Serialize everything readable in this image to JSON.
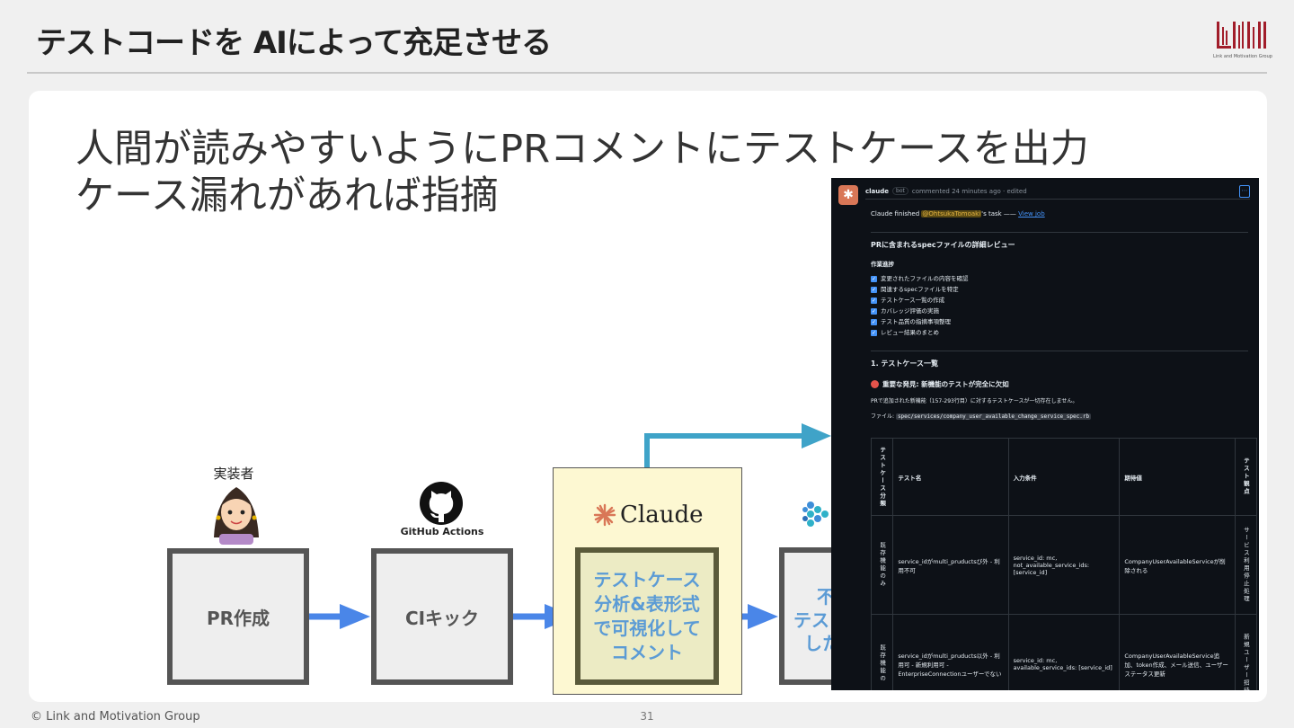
{
  "slide": {
    "title": "テストコードを AIによって充足させる",
    "headline_line1": "人間が読みやすいようにPRコメントにテストケースを出力",
    "headline_line2": "ケース漏れがあれば指摘",
    "logo_caption": "Link and Motivation Group",
    "footer_copyright": "© Link and Motivation Group",
    "page_number": "31"
  },
  "flow": {
    "actor_label": "実装者",
    "github_actions_label": "GitHub Actions",
    "claude_wordmark": "Claude",
    "steps": [
      {
        "label": "PR作成"
      },
      {
        "label": "CIキック"
      },
      {
        "lines": [
          "テストケース",
          "分析&表形式",
          "で可視化して",
          "コメント"
        ]
      },
      {
        "lines": [
          "不",
          "テス",
          "した"
        ]
      }
    ]
  },
  "comment": {
    "author": "claude",
    "bot_badge": "bot",
    "meta": "commented 24 minutes ago · edited",
    "finished_prefix": "Claude finished ",
    "mention": "@OhtsukaTomoaki",
    "finished_suffix": "'s task —— ",
    "view_job": "View job",
    "review_title": "PRに含まれるspecファイルの詳細レビュー",
    "progress_heading": "作業進捗",
    "tasks": [
      "変更されたファイルの内容を確認",
      "関連するspecファイルを特定",
      "テストケース一覧の作成",
      "カバレッジ評価の実施",
      "テスト品質の指摘事項整理",
      "レビュー結果のまとめ"
    ],
    "section_title": "1. テストケース一覧",
    "alert": "重要な発見: 新機能のテストが完全に欠如",
    "note": "PRで追加された新機能（157-293行目）に対するテストケースが一切存在しません。",
    "file_label": "ファイル: ",
    "file_path": "spec/services/company_user_available_change_service_spec.rb",
    "table": {
      "headers": [
        "テストケース分類",
        "テスト名",
        "入力条件",
        "期待値",
        "テスト観点"
      ],
      "rows": [
        {
          "category": "既存機能のみ",
          "name": "service_idがmulti_pruductsび外 - 利用不可",
          "input": "service_id: mc, not_available_service_ids: [service_id]",
          "expected": "CompanyUserAvailableServiceが削除される",
          "viewpoint": "サービス利用停止処理"
        },
        {
          "category": "既存機能の",
          "name": "service_idがmulti_pruducts以外 - 利用可 - 新規利用可 - EnterpriseConnectionユーザーでない",
          "input": "service_id: mc, available_service_ids: [service_id]",
          "expected": "CompanyUserAvailableService追加、token作成、メール送信、ユーザーステータス更新",
          "viewpoint": "新規ユーザー招待"
        }
      ]
    }
  }
}
